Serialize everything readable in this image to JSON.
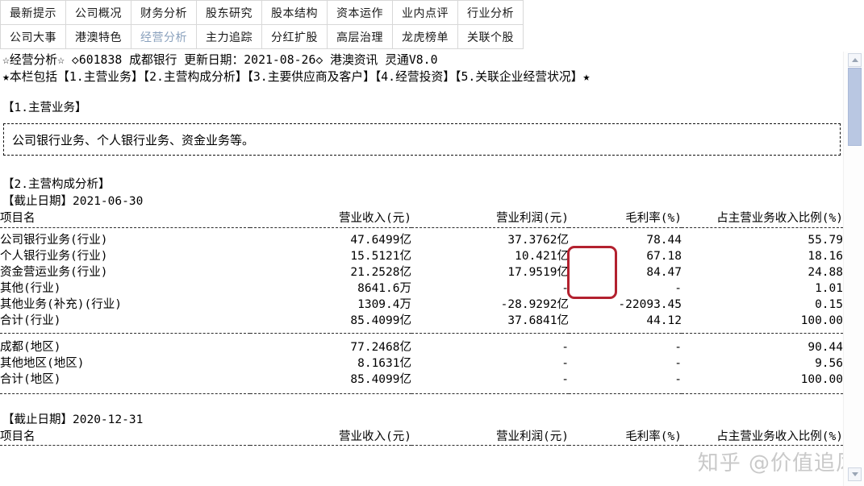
{
  "tabs": {
    "row1": [
      {
        "label": "最新提示",
        "active": false
      },
      {
        "label": "公司概况",
        "active": false
      },
      {
        "label": "财务分析",
        "active": false
      },
      {
        "label": "股东研究",
        "active": false
      },
      {
        "label": "股本结构",
        "active": false
      },
      {
        "label": "资本运作",
        "active": false
      },
      {
        "label": "业内点评",
        "active": false
      },
      {
        "label": "行业分析",
        "active": false
      }
    ],
    "row2": [
      {
        "label": "公司大事",
        "active": false
      },
      {
        "label": "港澳特色",
        "active": false
      },
      {
        "label": "经营分析",
        "active": true
      },
      {
        "label": "主力追踪",
        "active": false
      },
      {
        "label": "分红扩股",
        "active": false
      },
      {
        "label": "高层治理",
        "active": false
      },
      {
        "label": "龙虎榜单",
        "active": false
      },
      {
        "label": "关联个股",
        "active": false
      }
    ]
  },
  "header": {
    "title_line": "☆经营分析☆ ◇601838 成都银行 更新日期：2021-08-26◇ 港澳资讯 灵通V8.0",
    "toc_line": "★本栏包括【1.主营业务】【2.主营构成分析】【3.主要供应商及客户】【4.经营投资】【5.关联企业经营状况】★"
  },
  "section1": {
    "heading": "【1.主营业务】",
    "body": "公司银行业务、个人银行业务、资金业务等。"
  },
  "section2": {
    "heading": "【2.主营构成分析】",
    "period1_label": "【截止日期】2021-06-30",
    "period2_label": "【截止日期】2020-12-31",
    "columns": {
      "name": "项目名",
      "revenue": "营业收入(元)",
      "profit": "营业利润(元)",
      "margin": "毛利率(%)",
      "ratio": "占主营业务收入比例(%)"
    },
    "industry_rows": [
      {
        "name": "公司银行业务(行业)",
        "revenue": "47.6499亿",
        "profit": "37.3762亿",
        "margin": "78.44",
        "ratio": "55.79"
      },
      {
        "name": "个人银行业务(行业)",
        "revenue": "15.5121亿",
        "profit": "10.421亿",
        "margin": "67.18",
        "ratio": "18.16"
      },
      {
        "name": "资金营运业务(行业)",
        "revenue": "21.2528亿",
        "profit": "17.9519亿",
        "margin": "84.47",
        "ratio": "24.88"
      },
      {
        "name": "其他(行业)",
        "revenue": "8641.6万",
        "profit": "-",
        "margin": "-",
        "ratio": "1.01"
      },
      {
        "name": "其他业务(补充)(行业)",
        "revenue": "1309.4万",
        "profit": "-28.9292亿",
        "margin": "-22093.45",
        "ratio": "0.15"
      },
      {
        "name": "合计(行业)",
        "revenue": "85.4099亿",
        "profit": "37.6841亿",
        "margin": "44.12",
        "ratio": "100.00"
      }
    ],
    "region_rows": [
      {
        "name": "成都(地区)",
        "revenue": "77.2468亿",
        "profit": "-",
        "margin": "-",
        "ratio": "90.44"
      },
      {
        "name": "其他地区(地区)",
        "revenue": "8.1631亿",
        "profit": "-",
        "margin": "-",
        "ratio": "9.56"
      },
      {
        "name": "合计(地区)",
        "revenue": "85.4099亿",
        "profit": "-",
        "margin": "-",
        "ratio": "100.00"
      }
    ]
  },
  "annotation": {
    "color": "#b3212f",
    "highlights": [
      "78.44",
      "67.18",
      "84.47"
    ]
  },
  "watermark": {
    "text": "知乎 @价值追风"
  },
  "scrollbar": {
    "up_icon": "triangle-up-icon",
    "down_icon": "triangle-down-icon"
  }
}
